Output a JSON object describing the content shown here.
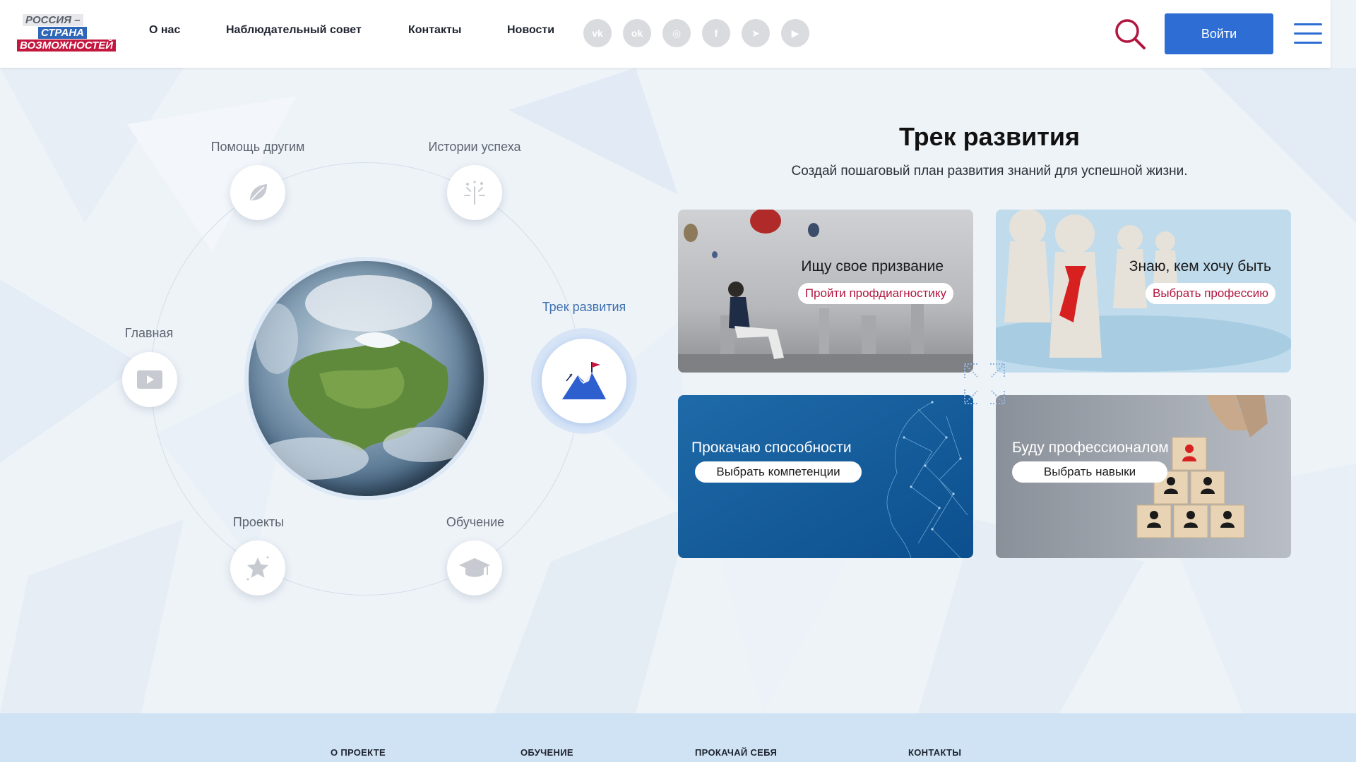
{
  "header": {
    "logo": {
      "line1": "РОССИЯ –",
      "line2": "СТРАНА",
      "line3": "ВОЗМОЖНОСТЕЙ"
    },
    "nav": [
      {
        "label": "О нас"
      },
      {
        "label": "Наблюдательный совет"
      },
      {
        "label": "Контакты"
      },
      {
        "label": "Новости"
      }
    ],
    "socials": [
      {
        "icon": "vk-icon",
        "glyph": "vk"
      },
      {
        "icon": "odnoklassniki-icon",
        "glyph": "ok"
      },
      {
        "icon": "instagram-icon",
        "glyph": "◎"
      },
      {
        "icon": "facebook-icon",
        "glyph": "f"
      },
      {
        "icon": "telegram-icon",
        "glyph": "➤"
      },
      {
        "icon": "youtube-icon",
        "glyph": "▶"
      }
    ],
    "login_label": "Войти",
    "accent_color": "#2e6ed4",
    "search_icon_color": "#b0163f"
  },
  "orbit": {
    "items": [
      {
        "label": "Помощь другим",
        "icon": "leaf-icon"
      },
      {
        "label": "Истории успеха",
        "icon": "fireworks-icon"
      },
      {
        "label": "Главная",
        "icon": "play-icon"
      },
      {
        "label": "Трек развития",
        "icon": "mountain-flag-icon",
        "active": true
      },
      {
        "label": "Проекты",
        "icon": "star-icon"
      },
      {
        "label": "Обучение",
        "icon": "graduation-cap-icon"
      }
    ]
  },
  "track": {
    "title": "Трек развития",
    "subtitle": "Создай пошаговый план развития знаний для успешной жизни.",
    "cards": [
      {
        "title": "Ищу свое призвание",
        "button": "Пройти профдиагностику"
      },
      {
        "title": "Знаю, кем хочу быть",
        "button": "Выбрать профессию"
      },
      {
        "title": "Прокачаю способности",
        "button": "Выбрать компетенции"
      },
      {
        "title": "Буду профессионалом",
        "button": "Выбрать навыки"
      }
    ]
  },
  "footer": {
    "links": [
      {
        "label": "О ПРОЕКТЕ"
      },
      {
        "label": "ОБУЧЕНИЕ"
      },
      {
        "label": "ПРОКАЧАЙ СЕБЯ"
      },
      {
        "label": "КОНТАКТЫ"
      }
    ]
  }
}
